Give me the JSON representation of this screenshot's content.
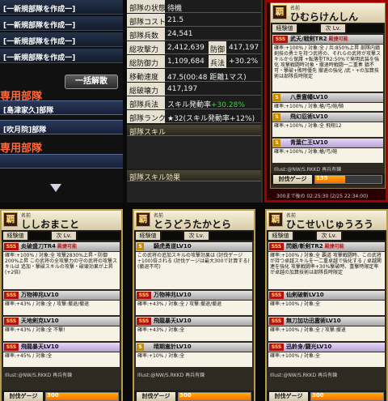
{
  "left": {
    "create_rows": [
      "[一新規部隊を作成一]",
      "[一新規部隊を作成一]",
      "[一新規部隊を作成一]",
      "[一新規部隊を作成一]"
    ],
    "special_heading": "専用部隊",
    "disband_button": "一括解散",
    "unit1": "[島津家久]部隊",
    "unit2": "[吹月院]部隊",
    "heading2": "専用部隊"
  },
  "stats": {
    "rows": [
      {
        "k": "部隊の状態",
        "v": "待機"
      },
      {
        "k": "部隊コスト",
        "v": "21.5"
      },
      {
        "k": "部隊兵数",
        "v": "24,541"
      },
      {
        "k": "総攻撃力",
        "v": "2,412,639",
        "k2": "防御",
        "v2": "417,197"
      },
      {
        "k": "総防御力",
        "v": "1,109,684",
        "k2": "兵法",
        "v2": "+30.2%"
      },
      {
        "k": "移動速度",
        "v": "47.5(00:48 距離1マス)"
      },
      {
        "k": "総破壊力",
        "v": "417,197"
      },
      {
        "k": "部隊兵法",
        "v": "スキル発動率",
        "vg": "+30.28%"
      },
      {
        "k": "部隊ランク",
        "v": "★32(スキル発動率+12%)"
      }
    ],
    "skill_head": "部隊スキル",
    "effect_head": "部隊スキル効果"
  },
  "top_right": {
    "rarity": "覇",
    "name_label": "名前",
    "name": "ひむらけんしん",
    "exp_label": "経験値",
    "lv_label": "次 Lv.",
    "skill1": "武天/戦剣TR2",
    "skill1_tag": "殿捷可能",
    "skill1_desc": "確率:+100% / 対象:全 / 兵:850%上昇 部隊内鎮剣技の勇士を持つ武将の、それらの武将が攻撃スキルから保護 +転落型TR2:50%で発明武装を強化 攻撃戦闘時対象・撤退時戦闘一二重奏 鎮不可・撃破+敗時優先 撤退の強化 /武・+の加算技術は部隊長時限定",
    "skill2": "八景霊幡LV10",
    "skill2_desc": "確率:+100% / 対象:槍/弓/砲/騎",
    "skill3": "飛幻忍術LV10",
    "skill3_desc": "確率:+100% / 対象:全 飛翔12",
    "skill4": "青葉仁王LV10",
    "skill4_desc": "確率:+100% / 対象:槍/弓/砲",
    "gauge_label": "討伐ゲージ",
    "gauge_value": "135",
    "gauge_fill": 0.45,
    "copyright": "Illust:@NW/S.RKKD 再兵有錬",
    "time_note": "300まで後の 02:25:30 (2/25 22:34:00)"
  },
  "cards": [
    {
      "rarity": "覇",
      "name_label": "名前",
      "name": "ししおまこと",
      "exp_label": "経験値",
      "lv_label": "次 Lv.",
      "skill1": "炎破盛刀TR4",
      "skill1_tag": "殿捷可能",
      "skill1_desc": "確率:+100% / 対象:全 攻撃2830%上昇・防御200%上昇 この武将の全攻撃力の守の武将の攻撃スキルは 追加・撃破スキルの攻撃・破壊効果が上昇(+2倍)",
      "skill2": "万物神兆LV10",
      "skill2_desc": "確率:+43% / 対象:全 / 攻撃:撤退/撤退",
      "skill3": "天地剣克LV10",
      "skill3_desc": "確率:+43% / 対象:全 不撃!",
      "skill4": "飛龍暴天LV10",
      "skill4_desc": "確率:+45% / 対象:全",
      "copyright": "Illust:@NW/S.RKKD 再兵有錬",
      "gauge_label": "討伐ゲージ",
      "gauge_value": "300",
      "gauge_fill": 1.0
    },
    {
      "rarity": "覇",
      "name_label": "名前",
      "name": "とうどうたかとら",
      "exp_label": "経験値",
      "lv_label": "次 Lv.",
      "skill1": "騎虎勇道LV10",
      "skill1_tag": "",
      "skill1_desc": "この武将の追加スキルの攻撃効果は (討伐ゲージ÷100)倍される (討伐ゲージは最大300で計算する) (撤退不可)",
      "skill2": "万物神兆LV10",
      "skill2_desc": "確率:+43% / 対象:全 / 攻撃:撤退/撤退",
      "skill3": "飛龍暴天LV10",
      "skill3_desc": "確率:+43% / 対象:全",
      "skill4": "晴期嵩計LV10",
      "skill4_desc": "確率:+10% / 対象:全",
      "copyright": "Illust:@NW/S.RKKD 再兵有錬",
      "gauge_label": "討伐ゲージ",
      "gauge_value": "300",
      "gauge_fill": 1.0
    },
    {
      "rarity": "覇",
      "name_label": "名前",
      "name": "ひこせいじゅうろう",
      "exp_label": "経験値",
      "lv_label": "次 Lv.",
      "skill1": "閃銀/斬剣TR2",
      "skill1_tag": "殿捷可能",
      "skill1_desc": "確率:+100% / 対象:全 覇道 攻撃戦闘時、この武将が持つ卓越スキルを一二重卓越で強化する / 卓越関連を強化 攻撃戦闘率+30%撃破時、重撃時限定率が卓越の加算技術は部隊長時限定",
      "skill2": "仙剣破斬LV10",
      "skill2_desc": "確率:+100% / 対象:全",
      "skill3": "無刀加功迅霊術LV10",
      "skill3_desc": "確率:+100% / 対象:全 / 攻撃:撤退",
      "skill4": "迅鈴身/闘光LV10",
      "skill4_desc": "確率:+100% / 対象:全",
      "copyright": "Illust:@NW/S.RKKD 再兵有錬",
      "gauge_label": "討伐ゲージ",
      "gauge_value": "300",
      "gauge_fill": 1.0
    }
  ]
}
